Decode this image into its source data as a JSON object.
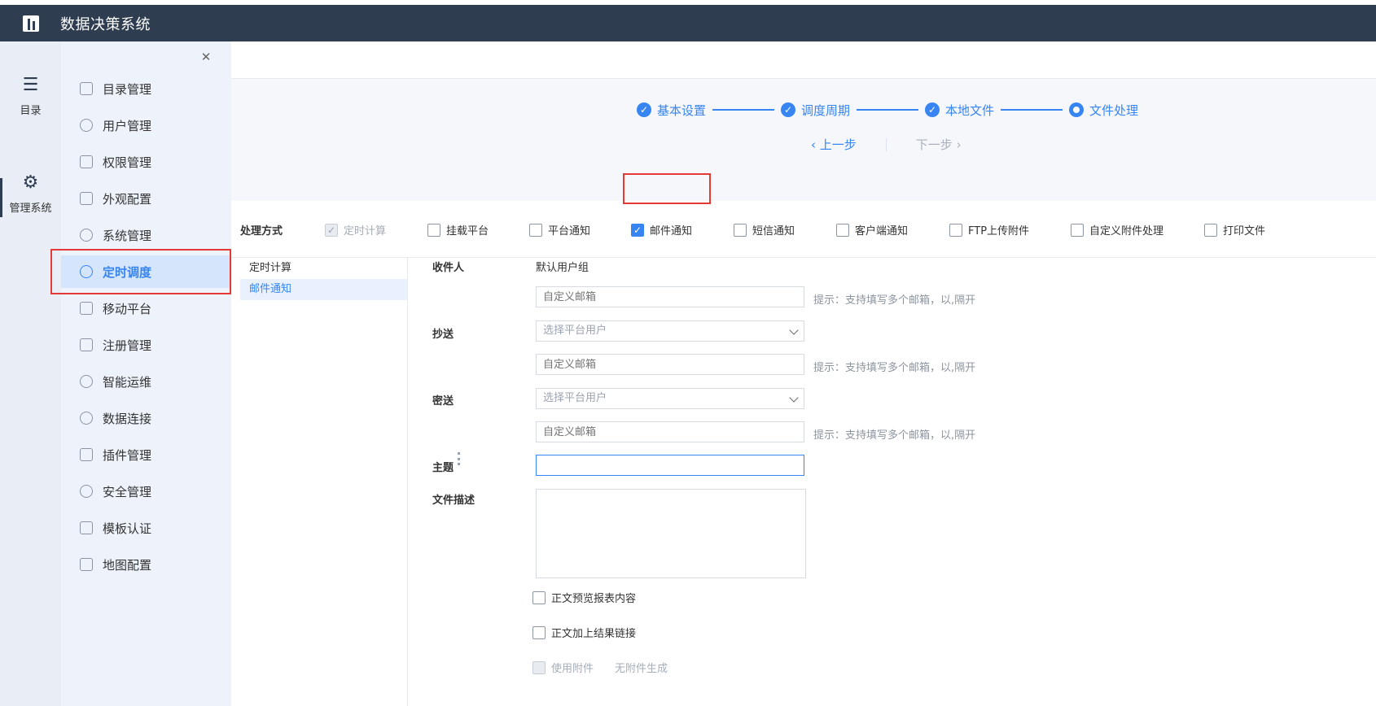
{
  "header": {
    "title": "数据决策系统"
  },
  "rail": {
    "items": [
      {
        "label": "目录",
        "icon": "list-icon"
      },
      {
        "label": "管理系统",
        "icon": "gear-icon"
      }
    ]
  },
  "menu": {
    "items": [
      {
        "label": "目录管理",
        "icon": "catalog-icon"
      },
      {
        "label": "用户管理",
        "icon": "user-icon"
      },
      {
        "label": "权限管理",
        "icon": "lock-icon"
      },
      {
        "label": "外观配置",
        "icon": "paint-roller-icon"
      },
      {
        "label": "系统管理",
        "icon": "settings-icon"
      },
      {
        "label": "定时调度",
        "icon": "timer-icon",
        "active": true
      },
      {
        "label": "移动平台",
        "icon": "mobile-icon"
      },
      {
        "label": "注册管理",
        "icon": "register-icon"
      },
      {
        "label": "智能运维",
        "icon": "network-icon"
      },
      {
        "label": "数据连接",
        "icon": "link-icon"
      },
      {
        "label": "插件管理",
        "icon": "plugin-icon"
      },
      {
        "label": "安全管理",
        "icon": "shield-icon"
      },
      {
        "label": "模板认证",
        "icon": "template-icon"
      },
      {
        "label": "地图配置",
        "icon": "map-icon"
      }
    ]
  },
  "steps": {
    "items": [
      {
        "label": "基本设置",
        "state": "done"
      },
      {
        "label": "调度周期",
        "state": "done"
      },
      {
        "label": "本地文件",
        "state": "done"
      },
      {
        "label": "文件处理",
        "state": "current"
      }
    ],
    "prev": "上一步",
    "next": "下一步"
  },
  "mode": {
    "label": "处理方式",
    "options": [
      {
        "label": "定时计算",
        "checked": true,
        "disabled": true
      },
      {
        "label": "挂载平台",
        "checked": false
      },
      {
        "label": "平台通知",
        "checked": false
      },
      {
        "label": "邮件通知",
        "checked": true
      },
      {
        "label": "短信通知",
        "checked": false
      },
      {
        "label": "客户端通知",
        "checked": false
      },
      {
        "label": "FTP上传附件",
        "checked": false
      },
      {
        "label": "自定义附件处理",
        "checked": false
      },
      {
        "label": "打印文件",
        "checked": false
      }
    ]
  },
  "subnav": {
    "items": [
      "定时计算",
      "邮件通知"
    ]
  },
  "form": {
    "recipient_label": "收件人",
    "recipient_default": "默认用户组",
    "custom_email_placeholder": "自定义邮箱",
    "hint": "提示：支持填写多个邮箱，以,隔开",
    "cc_label": "抄送",
    "select_user_placeholder": "选择平台用户",
    "bcc_label": "密送",
    "subject_label": "主题",
    "subject_value": "",
    "desc_label": "文件描述",
    "preview_label": "正文预览报表内容",
    "link_label": "正文加上结果链接",
    "attach_label": "使用附件",
    "no_attach": "无附件生成"
  }
}
